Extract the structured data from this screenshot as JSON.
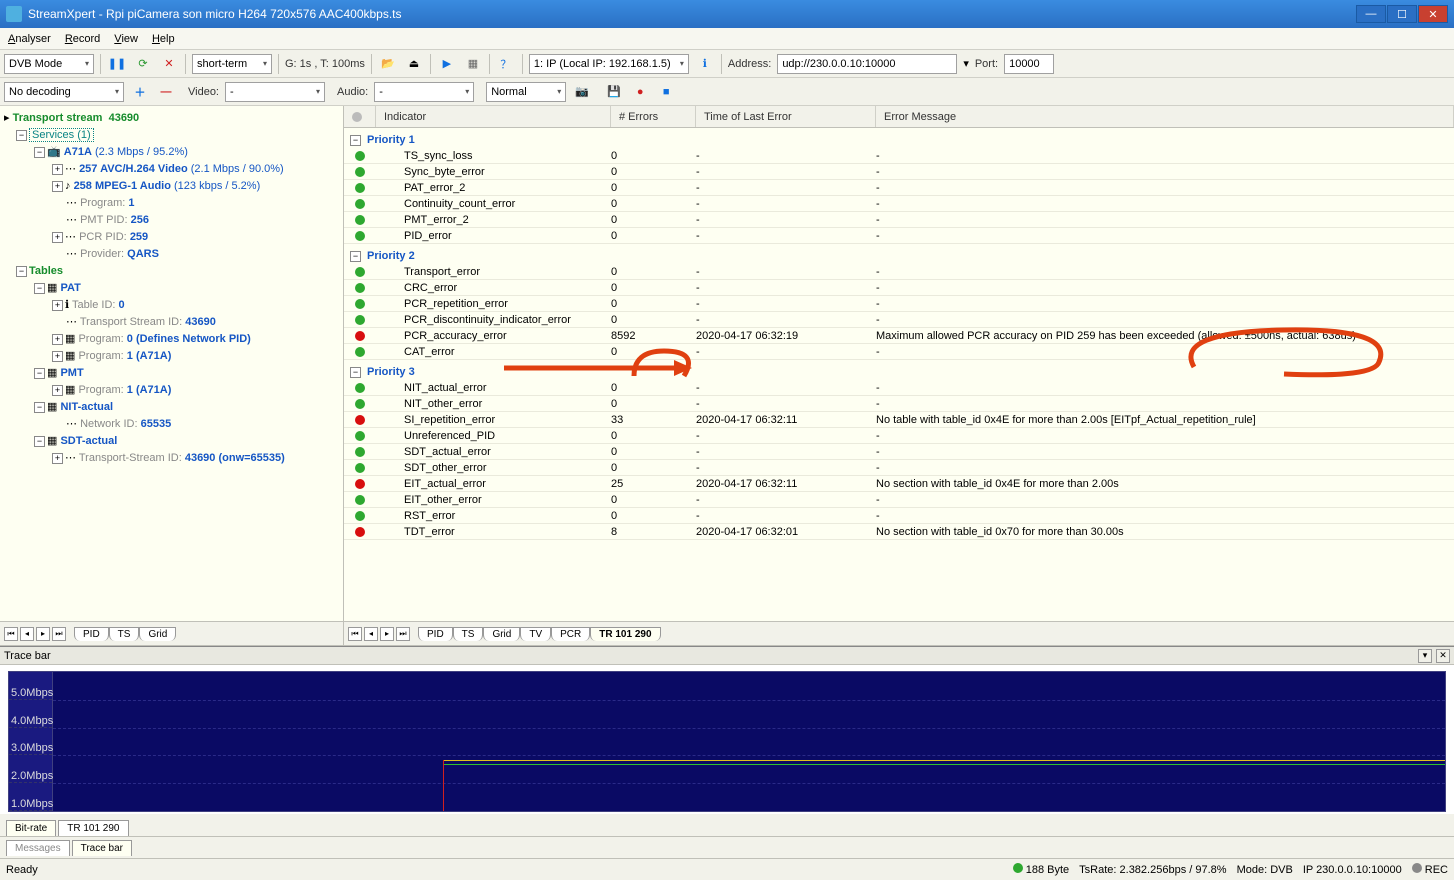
{
  "title": "StreamXpert - Rpi piCamera son micro H264 720x576 AAC400kbps.ts",
  "menus": [
    "Analyser",
    "Record",
    "View",
    "Help"
  ],
  "toolbar1": {
    "mode": "DVB Mode",
    "term": "short-term",
    "gt": "G: 1s , T: 100ms",
    "source": "1: IP (Local IP: 192.168.1.5)",
    "addr_lbl": "Address:",
    "addr": "udp://230.0.0.10:10000",
    "port_lbl": "Port:",
    "port": "10000"
  },
  "toolbar2": {
    "decode": "No decoding",
    "video_lbl": "Video:",
    "video": "-",
    "audio_lbl": "Audio:",
    "audio": "-",
    "normal": "Normal"
  },
  "tree": {
    "root": "Transport stream",
    "root_id": "43690",
    "services": "Services (1)",
    "svc": "A71A",
    "svc_info": "(2.3 Mbps / 95.2%)",
    "pid257": "257  AVC/H.264 Video",
    "pid257_info": "(2.1 Mbps / 90.0%)",
    "pid258": "258  MPEG-1 Audio",
    "pid258_info": "(123 kbps / 5.2%)",
    "program": "Program:",
    "program_v": "1",
    "pmtpid": "PMT PID:",
    "pmtpid_v": "256",
    "pcrpid": "PCR PID:",
    "pcrpid_v": "259",
    "provider": "Provider:",
    "provider_v": "QARS",
    "tables": "Tables",
    "pat": "PAT",
    "tableid": "Table ID:",
    "tableid_v": "0",
    "tsid": "Transport Stream ID:",
    "tsid_v": "43690",
    "prg0": "Program:",
    "prg0_v": "0  (Defines Network PID)",
    "prg1": "Program:",
    "prg1_v": "1  (A71A)",
    "pmt": "PMT",
    "pmt_prg": "Program:",
    "pmt_prg_v": "1  (A71A)",
    "nit": "NIT-actual",
    "netid": "Network ID:",
    "netid_v": "65535",
    "sdt": "SDT-actual",
    "sdt_ts": "Transport-Stream ID:",
    "sdt_ts_v": "43690  (onw=65535)"
  },
  "tabs_left": [
    "PID",
    "TS",
    "Grid"
  ],
  "tabs_right": [
    "PID",
    "TS",
    "Grid",
    "TV",
    "PCR",
    "TR 101 290"
  ],
  "cols": {
    "ind": "Indicator",
    "err": "# Errors",
    "time": "Time of Last Error",
    "msg": "Error Message"
  },
  "priorities": [
    "Priority 1",
    "Priority 2",
    "Priority 3"
  ],
  "p1": [
    {
      "s": "g",
      "n": "TS_sync_loss",
      "e": "0",
      "t": "-",
      "m": "-"
    },
    {
      "s": "g",
      "n": "Sync_byte_error",
      "e": "0",
      "t": "-",
      "m": "-"
    },
    {
      "s": "g",
      "n": "PAT_error_2",
      "e": "0",
      "t": "-",
      "m": "-"
    },
    {
      "s": "g",
      "n": "Continuity_count_error",
      "e": "0",
      "t": "-",
      "m": "-"
    },
    {
      "s": "g",
      "n": "PMT_error_2",
      "e": "0",
      "t": "-",
      "m": "-"
    },
    {
      "s": "g",
      "n": "PID_error",
      "e": "0",
      "t": "-",
      "m": "-"
    }
  ],
  "p2": [
    {
      "s": "g",
      "n": "Transport_error",
      "e": "0",
      "t": "-",
      "m": "-"
    },
    {
      "s": "g",
      "n": "CRC_error",
      "e": "0",
      "t": "-",
      "m": "-"
    },
    {
      "s": "g",
      "n": "PCR_repetition_error",
      "e": "0",
      "t": "-",
      "m": "-"
    },
    {
      "s": "g",
      "n": "PCR_discontinuity_indicator_error",
      "e": "0",
      "t": "-",
      "m": "-"
    },
    {
      "s": "r",
      "n": "PCR_accuracy_error",
      "e": "8592",
      "t": "2020-04-17 06:32:19",
      "m": "Maximum allowed PCR accuracy on PID 259 has been exceeded (allowed: ±500ns, actual: 638us)"
    },
    {
      "s": "g",
      "n": "CAT_error",
      "e": "0",
      "t": "-",
      "m": "-"
    }
  ],
  "p3": [
    {
      "s": "g",
      "n": "NIT_actual_error",
      "e": "0",
      "t": "-",
      "m": "-"
    },
    {
      "s": "g",
      "n": "NIT_other_error",
      "e": "0",
      "t": "-",
      "m": "-"
    },
    {
      "s": "r",
      "n": "SI_repetition_error",
      "e": "33",
      "t": "2020-04-17 06:32:11",
      "m": "No table with table_id 0x4E for more than 2.00s [EITpf_Actual_repetition_rule]"
    },
    {
      "s": "g",
      "n": "Unreferenced_PID",
      "e": "0",
      "t": "-",
      "m": "-"
    },
    {
      "s": "g",
      "n": "SDT_actual_error",
      "e": "0",
      "t": "-",
      "m": "-"
    },
    {
      "s": "g",
      "n": "SDT_other_error",
      "e": "0",
      "t": "-",
      "m": "-"
    },
    {
      "s": "r",
      "n": "EIT_actual_error",
      "e": "25",
      "t": "2020-04-17 06:32:11",
      "m": "No section with table_id 0x4E for more than 2.00s"
    },
    {
      "s": "g",
      "n": "EIT_other_error",
      "e": "0",
      "t": "-",
      "m": "-"
    },
    {
      "s": "g",
      "n": "RST_error",
      "e": "0",
      "t": "-",
      "m": "-"
    },
    {
      "s": "r",
      "n": "TDT_error",
      "e": "8",
      "t": "2020-04-17 06:32:01",
      "m": "No section with table_id 0x70 for more than 30.00s"
    }
  ],
  "trace": {
    "title": "Trace bar",
    "yl": [
      "5.0Mbps",
      "4.0Mbps",
      "3.0Mbps",
      "2.0Mbps",
      "1.0Mbps"
    ],
    "tabs": [
      "Bit-rate",
      "TR 101 290"
    ]
  },
  "btabs": [
    "Messages",
    "Trace bar"
  ],
  "status": {
    "ready": "Ready",
    "bytes": "188 Byte",
    "rate": "TsRate: 2.382.256bps / 97.8%",
    "mode": "Mode: DVB",
    "ip": "IP   230.0.0.10:10000",
    "rec": "REC"
  },
  "chart_data": {
    "type": "line",
    "title": "Bit-rate",
    "ylabel": "Mbps",
    "ylim": [
      0,
      5.5
    ],
    "series": [
      {
        "name": "bitrate",
        "approx_value": 2.0,
        "color": "#e0c020",
        "start_x_frac": 0.28
      }
    ],
    "marker": {
      "color": "#d02020",
      "x_frac": 0.28,
      "height": 2.0
    }
  }
}
